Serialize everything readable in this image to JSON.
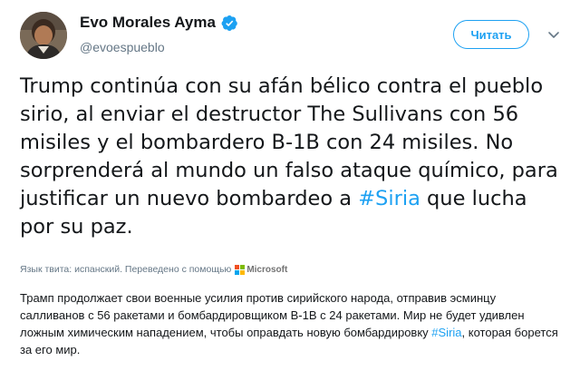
{
  "author": {
    "name": "Evo Morales Ayma",
    "handle": "@evoespueblo",
    "verified": true,
    "avatar_icon": "avatar-photo-icon"
  },
  "follow_button": {
    "label": "Читать"
  },
  "menu_icon": "chevron-down-icon",
  "tweet": {
    "text_before": "Trump continúa con su afán bélico contra el pueblo sirio, al enviar el destructor The Sullivans con 56 misiles y el bombardero B-1B con 24 misiles. No sorprenderá al mundo un falso ataque químico, para justificar un nuevo bombardeo a ",
    "hashtag": "#Siria",
    "text_after": " que lucha por su paz."
  },
  "translation_note": {
    "label": "Язык твита: испанский. Переведено с помощью",
    "provider": "Microsoft"
  },
  "translation": {
    "text_before": "Трамп продолжает свои военные усилия против сирийского народа, отправив эсминцу салливанов с 56 ракетами и бомбардировщиком B-1B с 24 ракетами. Мир не будет удивлен ложным химическим нападением, чтобы оправдать новую бомбардировку ",
    "hashtag": "#Siria",
    "text_after": ", которая борется за его мир."
  },
  "colors": {
    "accent": "#1da1f2",
    "text": "#14171a",
    "muted": "#657786",
    "ms_red": "#f25022",
    "ms_green": "#7fba00",
    "ms_blue": "#00a4ef",
    "ms_yellow": "#ffb900"
  }
}
